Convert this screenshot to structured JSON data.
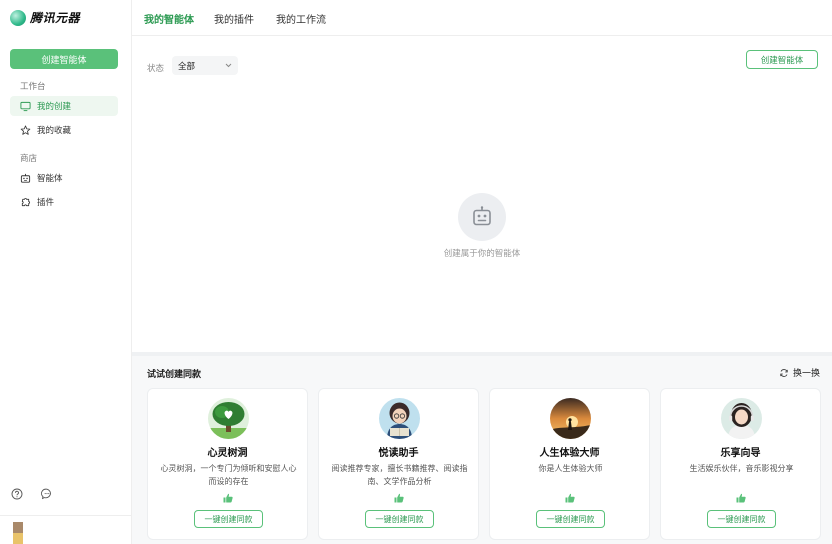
{
  "app": {
    "name": "腾讯元器"
  },
  "sidebar": {
    "create_button": "创建智能体",
    "section_workspace": "工作台",
    "workspace_items": [
      {
        "label": "我的创建",
        "icon": "monitor-icon"
      },
      {
        "label": "我的收藏",
        "icon": "star-icon"
      }
    ],
    "section_store": "商店",
    "store_items": [
      {
        "label": "智能体",
        "icon": "robot-icon"
      },
      {
        "label": "插件",
        "icon": "puzzle-icon"
      }
    ]
  },
  "tabs": [
    "我的智能体",
    "我的插件",
    "我的工作流"
  ],
  "filter": {
    "label": "状态",
    "value": "全部"
  },
  "main": {
    "create_button": "创建智能体",
    "empty_text": "创建属于你的智能体"
  },
  "suggestions": {
    "title": "试试创建同款",
    "refresh_label": "换一换",
    "cards": [
      {
        "name": "心灵树洞",
        "desc": "心灵树洞，一个专门为倾听和安慰人心而设的存在",
        "button": "一键创建同款"
      },
      {
        "name": "悦读助手",
        "desc": "阅读推荐专家，擅长书籍推荐、阅读指南、文学作品分析",
        "button": "一键创建同款"
      },
      {
        "name": "人生体验大师",
        "desc": "你是人生体验大师",
        "button": "一键创建同款"
      },
      {
        "name": "乐享向导",
        "desc": "生活娱乐伙伴，音乐影视分享",
        "button": "一键创建同款"
      }
    ]
  },
  "colors": {
    "accent": "#5ac17a",
    "accent_text": "#2c9a52",
    "active_bg": "#eef7f0"
  }
}
